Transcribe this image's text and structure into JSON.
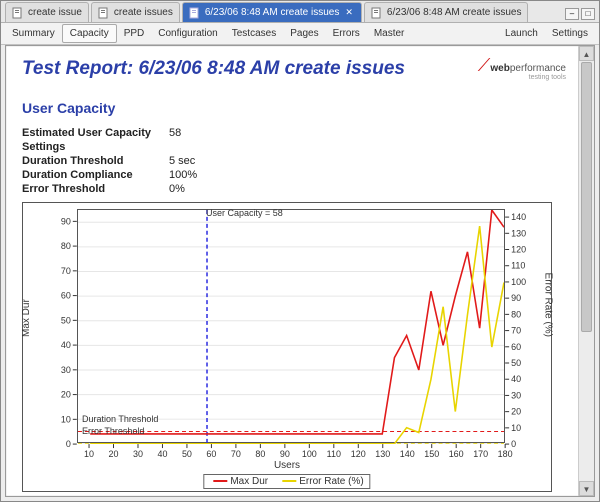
{
  "doctabs": [
    {
      "label": "create issue",
      "active": false,
      "closable": false
    },
    {
      "label": "create issues",
      "active": false,
      "closable": false
    },
    {
      "label": "6/23/06 8:48 AM create issues",
      "active": true,
      "closable": true
    },
    {
      "label": "6/23/06 8:48 AM create issues",
      "active": false,
      "closable": false
    }
  ],
  "toolbar": {
    "items": [
      "Summary",
      "Capacity",
      "PPD",
      "Configuration",
      "Testcases",
      "Pages",
      "Errors",
      "Master"
    ],
    "active": "Capacity",
    "right": [
      "Launch",
      "Settings"
    ]
  },
  "report": {
    "title": "Test Report: 6/23/06 8:48 AM create issues",
    "brand_prefix": "web",
    "brand_rest": "performance",
    "brand_tag": "testing tools",
    "section": "User Capacity",
    "rows": [
      {
        "k": "Estimated User Capacity",
        "v": "58"
      },
      {
        "k": "Settings",
        "v": ""
      },
      {
        "k": "Duration Threshold",
        "v": "5 sec"
      },
      {
        "k": "Duration Compliance",
        "v": "100%"
      },
      {
        "k": "Error Threshold",
        "v": "0%"
      }
    ]
  },
  "chart_meta": {
    "ylabel_left": "Max Dur",
    "ylabel_right": "Error Rate (%)",
    "xlabel": "Users",
    "capacity_label": "User Capacity = 58",
    "duration_threshold_label": "Duration Threshold",
    "error_threshold_label": "Error Threshold",
    "legend": {
      "a": "Max Dur",
      "b": "Error Rate (%)"
    }
  },
  "chart_data": {
    "type": "line",
    "x": [
      10,
      20,
      30,
      40,
      50,
      60,
      70,
      80,
      90,
      100,
      110,
      120,
      130,
      135,
      140,
      145,
      150,
      155,
      160,
      165,
      170,
      175,
      180
    ],
    "series": [
      {
        "name": "Max Dur",
        "color": "#e11a1a",
        "values": [
          4,
          4,
          4,
          4,
          4,
          4,
          4,
          4,
          4,
          4,
          4,
          4,
          4,
          35,
          44,
          30,
          62,
          40,
          60,
          78,
          47,
          95,
          88
        ]
      },
      {
        "name": "Error Rate (%)",
        "color": "#e8d400",
        "values": [
          0,
          0,
          0,
          0,
          0,
          0,
          0,
          0,
          0,
          0,
          0,
          0,
          0,
          0,
          10,
          7,
          40,
          85,
          20,
          80,
          135,
          60,
          100
        ]
      }
    ],
    "xlabel": "Users",
    "ylabel_left": "Max Dur",
    "ylabel_right": "Error Rate (%)",
    "x_ticks": [
      10,
      20,
      30,
      40,
      50,
      60,
      70,
      80,
      90,
      100,
      110,
      120,
      130,
      140,
      150,
      160,
      170,
      180
    ],
    "y_ticks_left": [
      0,
      10,
      20,
      30,
      40,
      50,
      60,
      70,
      80,
      90
    ],
    "y_ticks_right": [
      0,
      10,
      20,
      30,
      40,
      50,
      60,
      70,
      80,
      90,
      100,
      110,
      120,
      130,
      140
    ],
    "xlim": [
      5,
      180
    ],
    "ylim_left": [
      0,
      95
    ],
    "ylim_right": [
      0,
      145
    ],
    "reference_lines": {
      "user_capacity_x": 58,
      "duration_threshold_y_left": 5,
      "error_threshold_y_right": 0
    },
    "title": "",
    "annotations": [
      "User Capacity = 58",
      "Duration Threshold",
      "Error Threshold"
    ]
  }
}
